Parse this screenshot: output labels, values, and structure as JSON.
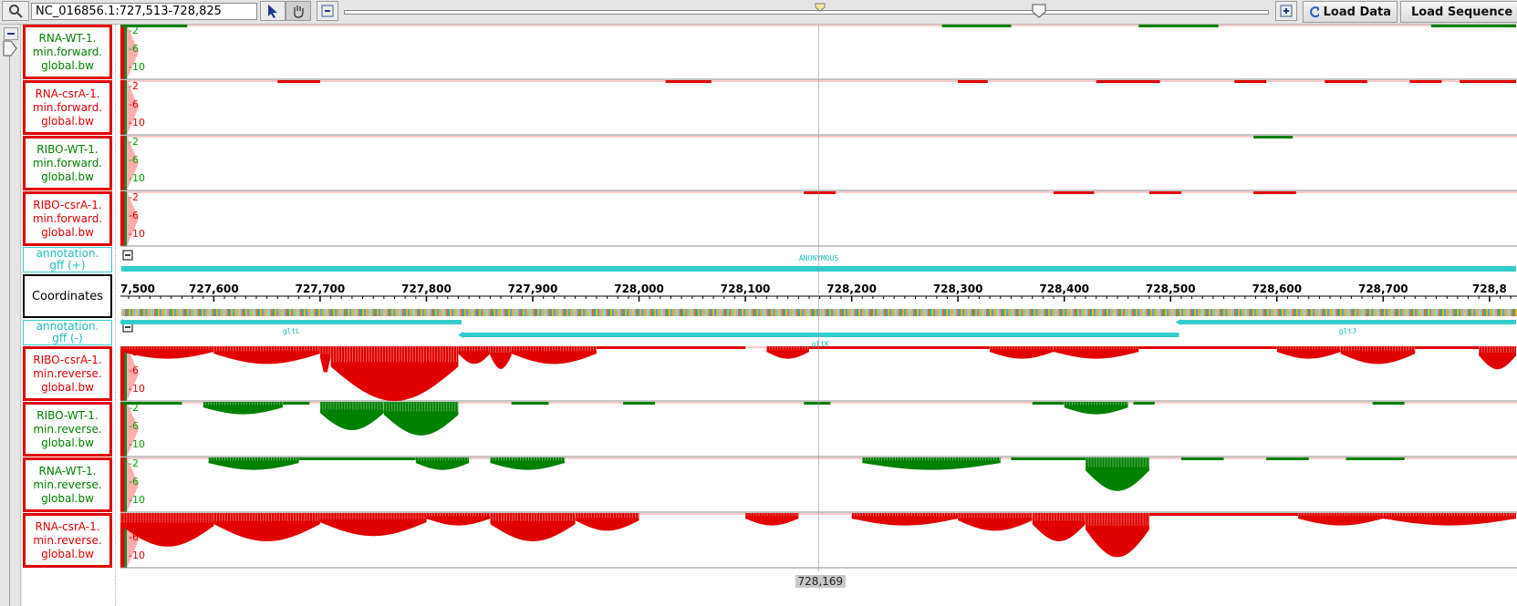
{
  "toolbar": {
    "location": "NC_016856.1:727,513-728,825",
    "load_data": "Load Data",
    "load_sequence": "Load Sequence"
  },
  "tracks_top": [
    {
      "label": "RNA-WT-1.\nmin.forward.\nglobal.bw",
      "color": "#008000",
      "bars": [
        [
          727513,
          727575,
          1
        ],
        [
          728285,
          728350,
          1
        ],
        [
          728470,
          728545,
          1
        ],
        [
          728745,
          728825,
          1
        ]
      ]
    },
    {
      "label": "RNA-csrA-1.\nmin.forward.\nglobal.bw",
      "color": "#e00000",
      "bars": [
        [
          727660,
          727700,
          1
        ],
        [
          728025,
          728068,
          1
        ],
        [
          728300,
          728328,
          1
        ],
        [
          728430,
          728490,
          1
        ],
        [
          728560,
          728590,
          1
        ],
        [
          728645,
          728685,
          1
        ],
        [
          728725,
          728755,
          1
        ],
        [
          728772,
          728825,
          1
        ]
      ]
    },
    {
      "label": "RIBO-WT-1.\nmin.forward.\nglobal.bw",
      "color": "#008000",
      "bars": [
        [
          728578,
          728615,
          1
        ]
      ]
    },
    {
      "label": "RIBO-csrA-1.\nmin.forward.\nglobal.bw",
      "color": "#e00000",
      "bars": [
        [
          728155,
          728185,
          1
        ],
        [
          728390,
          728428,
          1
        ],
        [
          728480,
          728510,
          1
        ],
        [
          728578,
          728618,
          1
        ]
      ]
    }
  ],
  "annotation_plus": {
    "label": "annotation.\ngff (+)",
    "feature": "ANONYMOUS",
    "start": 727513,
    "end": 728825
  },
  "coordinates": {
    "label": "Coordinates",
    "start": 727513,
    "end": 728825,
    "ticks": [
      727500,
      727600,
      727700,
      727800,
      727900,
      728000,
      728100,
      728200,
      728300,
      728400,
      728500,
      728600,
      728700,
      728800
    ],
    "tick_labels": [
      "7,500",
      "727,600",
      "727,700",
      "727,800",
      "727,900",
      "728,000",
      "728,100",
      "728,200",
      "728,300",
      "728,400",
      "728,500",
      "728,600",
      "728,700",
      "728,8"
    ]
  },
  "annotation_minus": {
    "label": "annotation.\ngff (-)",
    "genes": [
      {
        "name": "gltL",
        "start": 727513,
        "end": 727833,
        "row": 0
      },
      {
        "name": "gltK",
        "start": 727833,
        "end": 728508,
        "row": 1
      },
      {
        "name": "gltJ",
        "start": 728508,
        "end": 728825,
        "row": 0
      }
    ]
  },
  "tracks_bottom": [
    {
      "label": "RIBO-csrA-1.\nmin.reverse.\nglobal.bw",
      "color": "#e00000",
      "bars": [
        [
          727513,
          727600,
          2
        ],
        [
          727600,
          727700,
          3
        ],
        [
          727700,
          727710,
          5
        ],
        [
          727710,
          727830,
          10
        ],
        [
          727830,
          727860,
          3
        ],
        [
          727860,
          727880,
          4
        ],
        [
          727880,
          727960,
          3
        ],
        [
          727960,
          728000,
          1
        ],
        [
          728000,
          728100,
          1
        ],
        [
          728120,
          728160,
          2
        ],
        [
          728160,
          728200,
          1
        ],
        [
          728200,
          728330,
          1
        ],
        [
          728330,
          728390,
          2
        ],
        [
          728390,
          728470,
          2
        ],
        [
          728470,
          728600,
          1
        ],
        [
          728600,
          728660,
          2
        ],
        [
          728660,
          728730,
          3
        ],
        [
          728730,
          728790,
          1
        ],
        [
          728790,
          728825,
          4
        ]
      ]
    },
    {
      "label": "RIBO-WT-1.\nmin.reverse.\nglobal.bw",
      "color": "#008000",
      "bars": [
        [
          727513,
          727570,
          1
        ],
        [
          727590,
          727665,
          2
        ],
        [
          727665,
          727690,
          1
        ],
        [
          727700,
          727760,
          5
        ],
        [
          727760,
          727830,
          6
        ],
        [
          727880,
          727915,
          1
        ],
        [
          727985,
          728015,
          1
        ],
        [
          728155,
          728180,
          1
        ],
        [
          728370,
          728400,
          1
        ],
        [
          728400,
          728460,
          2
        ],
        [
          728465,
          728485,
          1
        ],
        [
          728690,
          728720,
          1
        ]
      ]
    },
    {
      "label": "RNA-WT-1.\nmin.reverse.\nglobal.bw",
      "color": "#008000",
      "bars": [
        [
          727595,
          727680,
          2
        ],
        [
          727680,
          727790,
          1
        ],
        [
          727790,
          727840,
          2
        ],
        [
          727860,
          727930,
          2
        ],
        [
          728210,
          728340,
          2
        ],
        [
          728350,
          728420,
          1
        ],
        [
          728420,
          728480,
          6
        ],
        [
          728510,
          728550,
          1
        ],
        [
          728590,
          728630,
          1
        ],
        [
          728665,
          728720,
          1
        ]
      ]
    },
    {
      "label": "RNA-csrA-1.\nmin.reverse.\nglobal.bw",
      "color": "#e00000",
      "bars": [
        [
          727513,
          727600,
          6
        ],
        [
          727600,
          727700,
          5
        ],
        [
          727700,
          727800,
          4
        ],
        [
          727800,
          727860,
          2
        ],
        [
          727860,
          727940,
          5
        ],
        [
          727940,
          728000,
          3
        ],
        [
          728100,
          728150,
          2
        ],
        [
          728200,
          728300,
          2
        ],
        [
          728300,
          728370,
          3
        ],
        [
          728370,
          728420,
          5
        ],
        [
          728420,
          728480,
          8
        ],
        [
          728480,
          728620,
          1
        ],
        [
          728620,
          728700,
          2
        ],
        [
          728700,
          728825,
          2
        ]
      ]
    }
  ],
  "axis_labels": [
    "2",
    "6",
    "10"
  ],
  "cursor_position": "728,169",
  "cursor_bp": 728169
}
